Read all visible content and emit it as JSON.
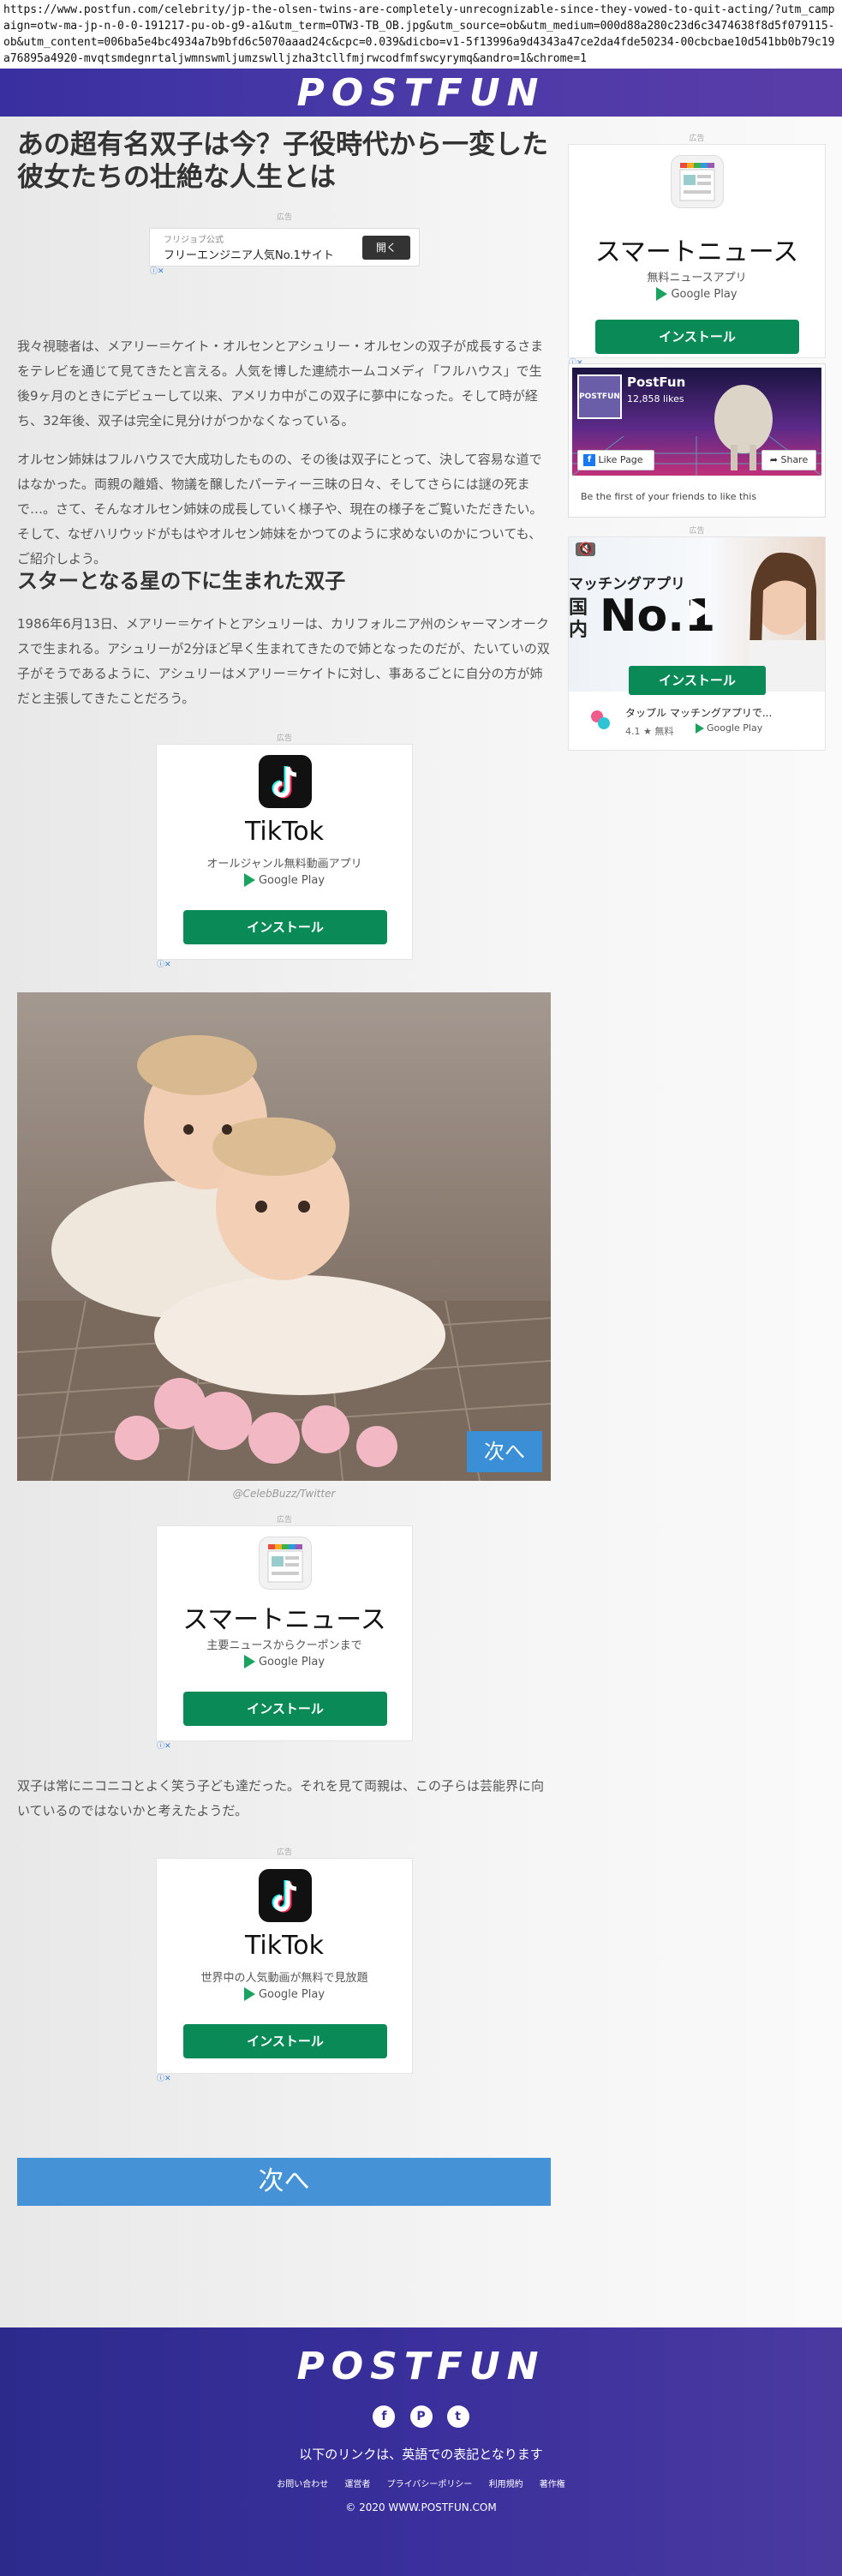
{
  "browser": {
    "url": "https://www.postfun.com/celebrity/jp-the-olsen-twins-are-completely-unrecognizable-since-they-vowed-to-quit-acting/?utm_campaign=otw-ma-jp-n-0-0-191217-pu-ob-g9-a1&utm_term=OTW3-TB_OB.jpg&utm_source=ob&utm_medium=000d88a280c23d6c3474638f8d5f079115-ob&utm_content=006ba5e4bc4934a7b9bfd6c5070aaad24c&cpc=0.039&dicbo=v1-5f13996a9d4343a47ce2da4fde50234-00cbcbae10d541bb0b79c19a76895a4920-mvqtsmdegnrtaljwmnswmljumzswlljzha3tcllfmjrwcodfmfswcyrymq&andro=1&chrome=1"
  },
  "header": {
    "logo": "POSTFUN"
  },
  "article": {
    "title": "あの超有名双子は今？子役時代から一変した彼女たちの壮絶な人生とは",
    "ad_label": "広告",
    "top_ad": {
      "sponsor": "フリジョブ公式",
      "text": "フリーエンジニア人気No.1サイト",
      "button": "開く",
      "adchoice": "ⓘ✕"
    },
    "para1": "我々視聴者は、メアリー＝ケイト・オルセンとアシュリー・オルセンの双子が成長するさまをテレビを通じて見てきたと言える。人気を博した連続ホームコメディ「フルハウス」で生後9ヶ月のときにデビューして以来、アメリカ中がこの双子に夢中になった。そして時が経ち、32年後、双子は完全に見分けがつかなくなっている。",
    "para2": "オルセン姉妹はフルハウスで大成功したものの、その後は双子にとって、決して容易な道ではなかった。両親の離婚、物議を醸したパーティー三昧の日々、そしてさらには謎の死まで…。さて、そんなオルセン姉妹の成長していく様子や、現在の様子をご覧いただきたい。そして、なぜハリウッドがもはやオルセン姉妹をかつてのように求めないのかについても、ご紹介しよう。",
    "heading": "スターとなる星の下に生まれた双子",
    "para3": "1986年6月13日、メアリー＝ケイトとアシュリーは、カリフォルニア州のシャーマンオークスで生まれる。アシュリーが2分ほど早く生まれてきたので姉となったのだが、たいていの双子がそうであるように、アシュリーはメアリー＝ケイトに対し、事あるごとに自分の方が姉だと主張してきたことだろう。",
    "tiktok_ad1": {
      "name": "TikTok",
      "sub": "オールジャンル無料動画アプリ",
      "store": "Google Play",
      "button": "インストール"
    },
    "photo_next": "次へ",
    "photo_caption": "@CelebBuzz/Twitter",
    "news_ad": {
      "name": "スマートニュース",
      "sub": "主要ニュースからクーポンまで",
      "store": "Google Play",
      "button": "インストール"
    },
    "para4": "双子は常にニコニコとよく笑う子ども達だった。それを見て両親は、この子らは芸能界に向いているのではないかと考えたようだ。",
    "tiktok_ad2": {
      "name": "TikTok",
      "sub": "世界中の人気動画が無料で見放題",
      "store": "Google Play",
      "button": "インストール"
    },
    "next_button": "次へ"
  },
  "sidebar": {
    "ad_label": "広告",
    "news_ad": {
      "name": "スマートニュース",
      "sub": "無料ニュースアプリ",
      "store": "Google Play",
      "button": "インストール"
    },
    "fb": {
      "page": "PostFun",
      "likes": "12,858 likes",
      "like_button": "Like Page",
      "share_button": "Share",
      "note": "Be the first of your friends to like this"
    },
    "match_ad": {
      "headline1": "マッチングアプリ",
      "headline2": "国内",
      "headline3": "No.1",
      "button": "インストール",
      "app": "タップル マッチングアプリで...",
      "rating": "4.1 ★ 無料",
      "store": "Google Play"
    }
  },
  "footer": {
    "logo": "POSTFUN",
    "social": [
      "f",
      "P",
      "t"
    ],
    "note": "以下のリンクは、英語での表記となります",
    "links": [
      "お問い合わせ",
      "運営者",
      "プライバシーポリシー",
      "利用規約",
      "著作権"
    ],
    "copyright": "© 2020 WWW.POSTFUN.COM"
  },
  "colors": {
    "brand": "#3a2fa0",
    "install": "#0a8a57",
    "next": "#4593d6"
  }
}
